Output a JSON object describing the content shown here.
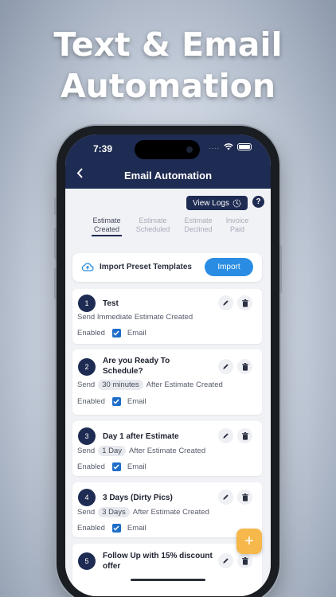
{
  "headline": {
    "line1": "Text & Email",
    "line2": "Automation"
  },
  "status_bar": {
    "time": "7:39",
    "dots": "...."
  },
  "header": {
    "title": "Email Automation"
  },
  "toolbar": {
    "view_logs": "View Logs",
    "help": "?"
  },
  "tabs": [
    {
      "line1": "Estimate",
      "line2": "Created",
      "active": true
    },
    {
      "line1": "Estimate",
      "line2": "Scheduled",
      "active": false
    },
    {
      "line1": "Estimate",
      "line2": "Declined",
      "active": false
    },
    {
      "line1": "Invoice",
      "line2": "Paid",
      "active": false
    }
  ],
  "import_card": {
    "text": "Import Preset Templates",
    "button": "Import"
  },
  "automations": [
    {
      "number": "1",
      "title": "Test",
      "send_label": "Send Immediate Estimate Created",
      "chip": "",
      "after": "",
      "enabled_label": "Enabled",
      "channel": "Email"
    },
    {
      "number": "2",
      "title_line1": "Are you Ready To",
      "title_line2": "Schedule?",
      "send_label": "Send",
      "chip": "30 minutes",
      "after": "After Estimate Created",
      "enabled_label": "Enabled",
      "channel": "Email"
    },
    {
      "number": "3",
      "title": "Day 1 after Estimate",
      "send_label": "Send",
      "chip": "1 Day",
      "after": "After Estimate Created",
      "enabled_label": "Enabled",
      "channel": "Email"
    },
    {
      "number": "4",
      "title": "3  Days  (Dirty Pics)",
      "send_label": "Send",
      "chip": "3 Days",
      "after": "After Estimate Created",
      "enabled_label": "Enabled",
      "channel": "Email"
    },
    {
      "number": "5",
      "title_line1": "Follow Up with 15% discount",
      "title_line2": "offer"
    }
  ],
  "fab": {
    "label": "+"
  },
  "colors": {
    "navy": "#1e2b52",
    "accent_blue": "#2a8de3",
    "fab_orange": "#f6b84a"
  }
}
